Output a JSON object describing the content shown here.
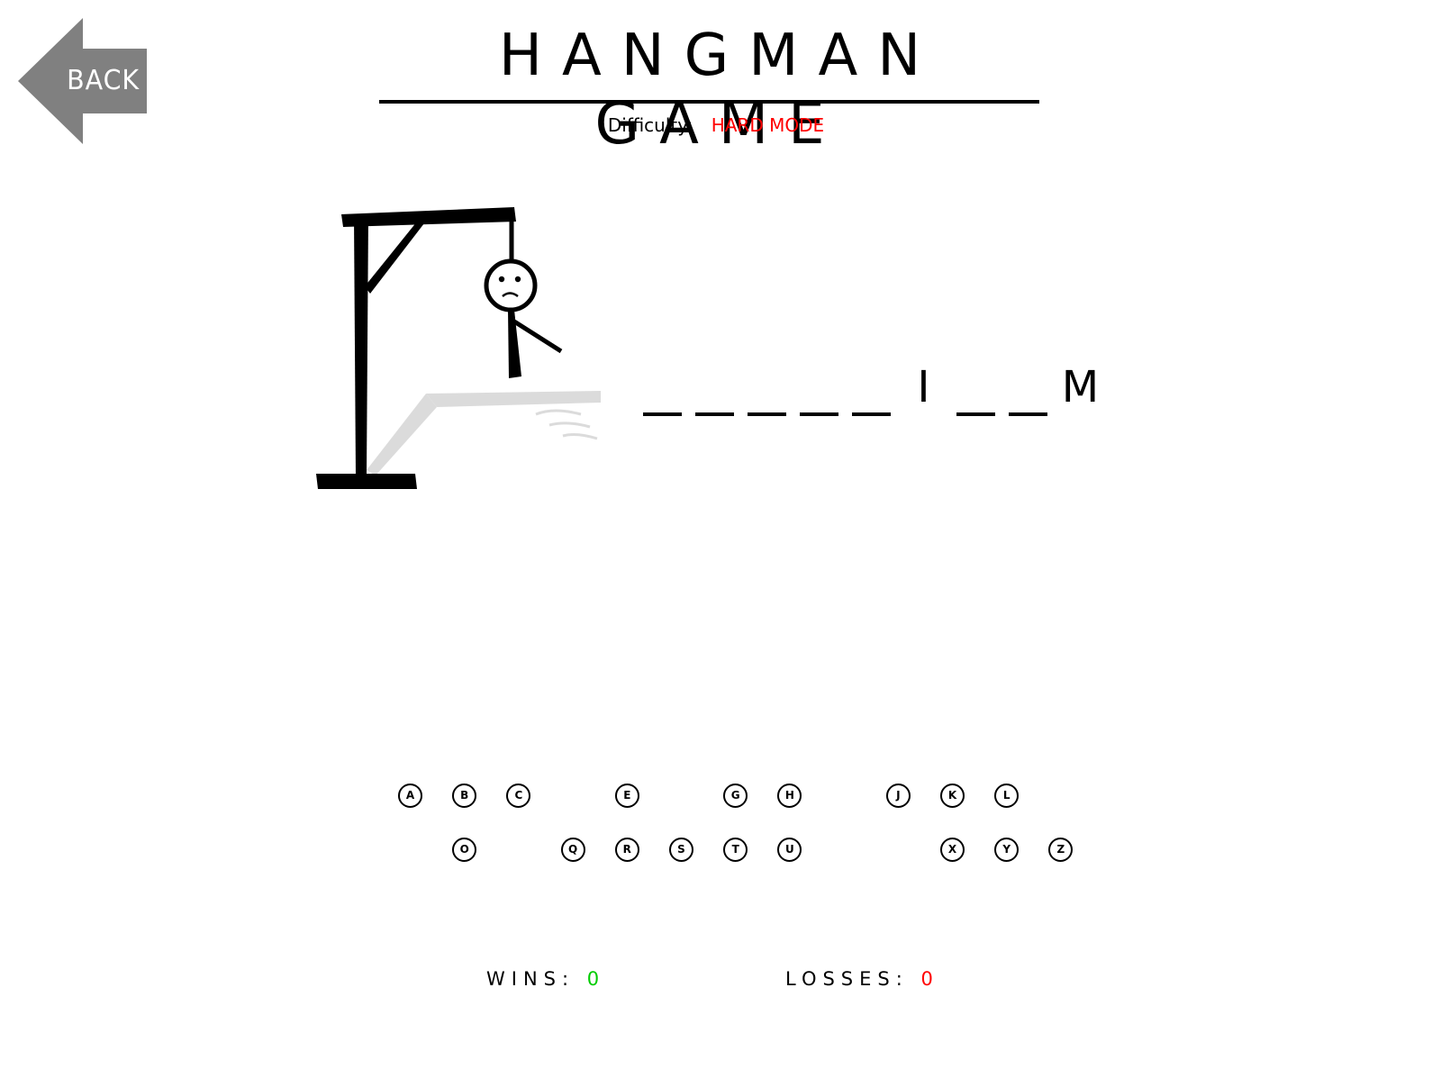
{
  "back": {
    "label": "BACK",
    "color": "#808080"
  },
  "title": "HANGMAN GAME",
  "difficulty": {
    "label": "Difficulty:",
    "value": "HARD MODE",
    "value_color": "#ff0000"
  },
  "word": {
    "slots": [
      "",
      "",
      "",
      "",
      "",
      "I",
      "",
      "",
      "M"
    ]
  },
  "keyboard": {
    "row1": [
      "A",
      "B",
      "C",
      "E",
      "G",
      "H",
      "J",
      "K",
      "L"
    ],
    "row2": [
      "O",
      "Q",
      "R",
      "S",
      "T",
      "U",
      "X",
      "Y",
      "Z"
    ]
  },
  "score": {
    "wins_label": "WINS:",
    "wins_value": "0",
    "wins_color": "#00cc00",
    "losses_label": "LOSSES:",
    "losses_value": "0",
    "losses_color": "#ff0000"
  },
  "hangman": {
    "parts_shown": [
      "head",
      "body",
      "right-arm"
    ],
    "face": "sad"
  }
}
